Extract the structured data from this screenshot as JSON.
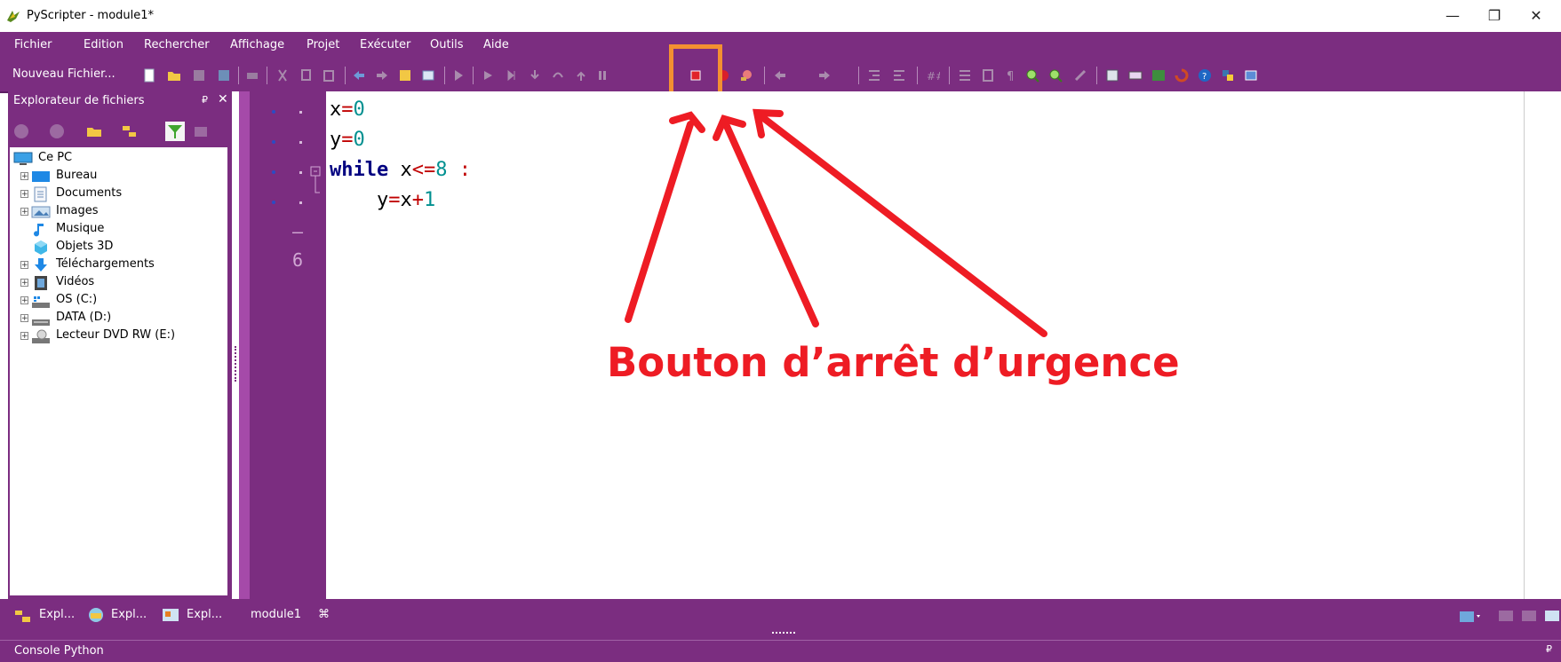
{
  "window": {
    "title": "PyScripter - module1*",
    "controls": {
      "minimize": "—",
      "maximize": "❐",
      "close": "✕"
    }
  },
  "menu": [
    "Fichier",
    "Edition",
    "Rechercher",
    "Affichage",
    "Projet",
    "Exécuter",
    "Outils",
    "Aide"
  ],
  "toolbar": {
    "new_file_label": "Nouveau Fichier..."
  },
  "file_explorer": {
    "title": "Explorateur de fichiers",
    "pin": "₽",
    "close": "✕",
    "tree": [
      {
        "label": "Ce PC",
        "expandable": false,
        "icon": "pc-icon"
      },
      {
        "label": "Bureau",
        "expandable": true,
        "icon": "desktop-folder-icon"
      },
      {
        "label": "Documents",
        "expandable": true,
        "icon": "documents-folder-icon"
      },
      {
        "label": "Images",
        "expandable": true,
        "icon": "images-folder-icon"
      },
      {
        "label": "Musique",
        "expandable": false,
        "icon": "music-folder-icon"
      },
      {
        "label": "Objets 3D",
        "expandable": false,
        "icon": "3d-objects-folder-icon"
      },
      {
        "label": "Téléchargements",
        "expandable": true,
        "icon": "downloads-folder-icon"
      },
      {
        "label": "Vidéos",
        "expandable": true,
        "icon": "videos-folder-icon"
      },
      {
        "label": "OS (C:)",
        "expandable": true,
        "icon": "drive-icon"
      },
      {
        "label": "DATA (D:)",
        "expandable": true,
        "icon": "drive-icon"
      },
      {
        "label": "Lecteur DVD RW (E:)",
        "expandable": true,
        "icon": "dvd-drive-icon"
      }
    ]
  },
  "editor": {
    "gutter_numbers": [
      "—",
      "6"
    ],
    "code": {
      "line1": {
        "id": "x",
        "op": "=",
        "num": "0"
      },
      "line2": {
        "id": "y",
        "op": "=",
        "num": "0"
      },
      "line3": {
        "kw": "while",
        "id": "x",
        "op": "<=",
        "num": "8",
        "colon": ":"
      },
      "line4": {
        "indent": "    ",
        "id": "y",
        "op1": "=",
        "id2": "x",
        "op2": "+",
        "num": "1"
      }
    }
  },
  "annotation": {
    "text": "Bouton d’arrêt d’urgence",
    "color": "#ee1c24",
    "highlight_color": "#f39031"
  },
  "bottom_tabs": [
    "Expl...",
    "Expl...",
    "Expl..."
  ],
  "editor_tab": {
    "label": "module1",
    "close": "⌘"
  },
  "status": {
    "label": "Console Python",
    "pin": "₽"
  },
  "colors": {
    "theme_purple": "#7b2d80",
    "gutter_purple": "#a54aa9"
  }
}
